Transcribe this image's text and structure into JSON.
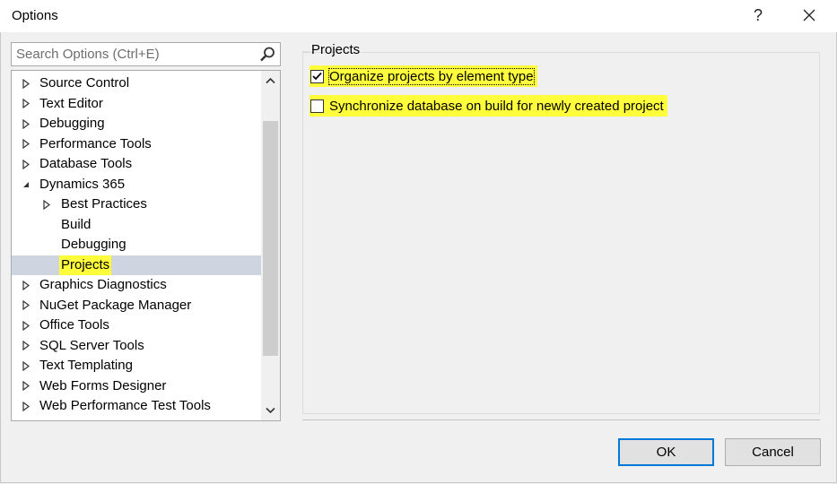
{
  "window": {
    "title": "Options",
    "help_glyph": "?",
    "close_glyph": "✕"
  },
  "search": {
    "placeholder": "Search Options (Ctrl+E)"
  },
  "tree": {
    "items": [
      {
        "label": "Source Control",
        "level": 0,
        "expander": "collapsed"
      },
      {
        "label": "Text Editor",
        "level": 0,
        "expander": "collapsed"
      },
      {
        "label": "Debugging",
        "level": 0,
        "expander": "collapsed"
      },
      {
        "label": "Performance Tools",
        "level": 0,
        "expander": "collapsed"
      },
      {
        "label": "Database Tools",
        "level": 0,
        "expander": "collapsed"
      },
      {
        "label": "Dynamics 365",
        "level": 0,
        "expander": "expanded"
      },
      {
        "label": "Best Practices",
        "level": 1,
        "expander": "collapsed"
      },
      {
        "label": "Build",
        "level": 1,
        "expander": "none"
      },
      {
        "label": "Debugging",
        "level": 1,
        "expander": "none"
      },
      {
        "label": "Projects",
        "level": 1,
        "expander": "none",
        "selected": true,
        "highlighted": true
      },
      {
        "label": "Graphics Diagnostics",
        "level": 0,
        "expander": "collapsed"
      },
      {
        "label": "NuGet Package Manager",
        "level": 0,
        "expander": "collapsed"
      },
      {
        "label": "Office Tools",
        "level": 0,
        "expander": "collapsed"
      },
      {
        "label": "SQL Server Tools",
        "level": 0,
        "expander": "collapsed"
      },
      {
        "label": "Text Templating",
        "level": 0,
        "expander": "collapsed"
      },
      {
        "label": "Web Forms Designer",
        "level": 0,
        "expander": "collapsed"
      },
      {
        "label": "Web Performance Test Tools",
        "level": 0,
        "expander": "collapsed"
      }
    ]
  },
  "panel": {
    "group_title": "Projects",
    "options": [
      {
        "label": "Organize projects by element type",
        "checked": true,
        "focused": true
      },
      {
        "label": "Synchronize database on build for newly created project",
        "checked": false,
        "focused": false
      }
    ]
  },
  "buttons": {
    "ok": "OK",
    "cancel": "Cancel"
  },
  "colors": {
    "highlight": "#ffff3c",
    "selection": "#cfd5e0",
    "focus_border": "#0078d7"
  }
}
